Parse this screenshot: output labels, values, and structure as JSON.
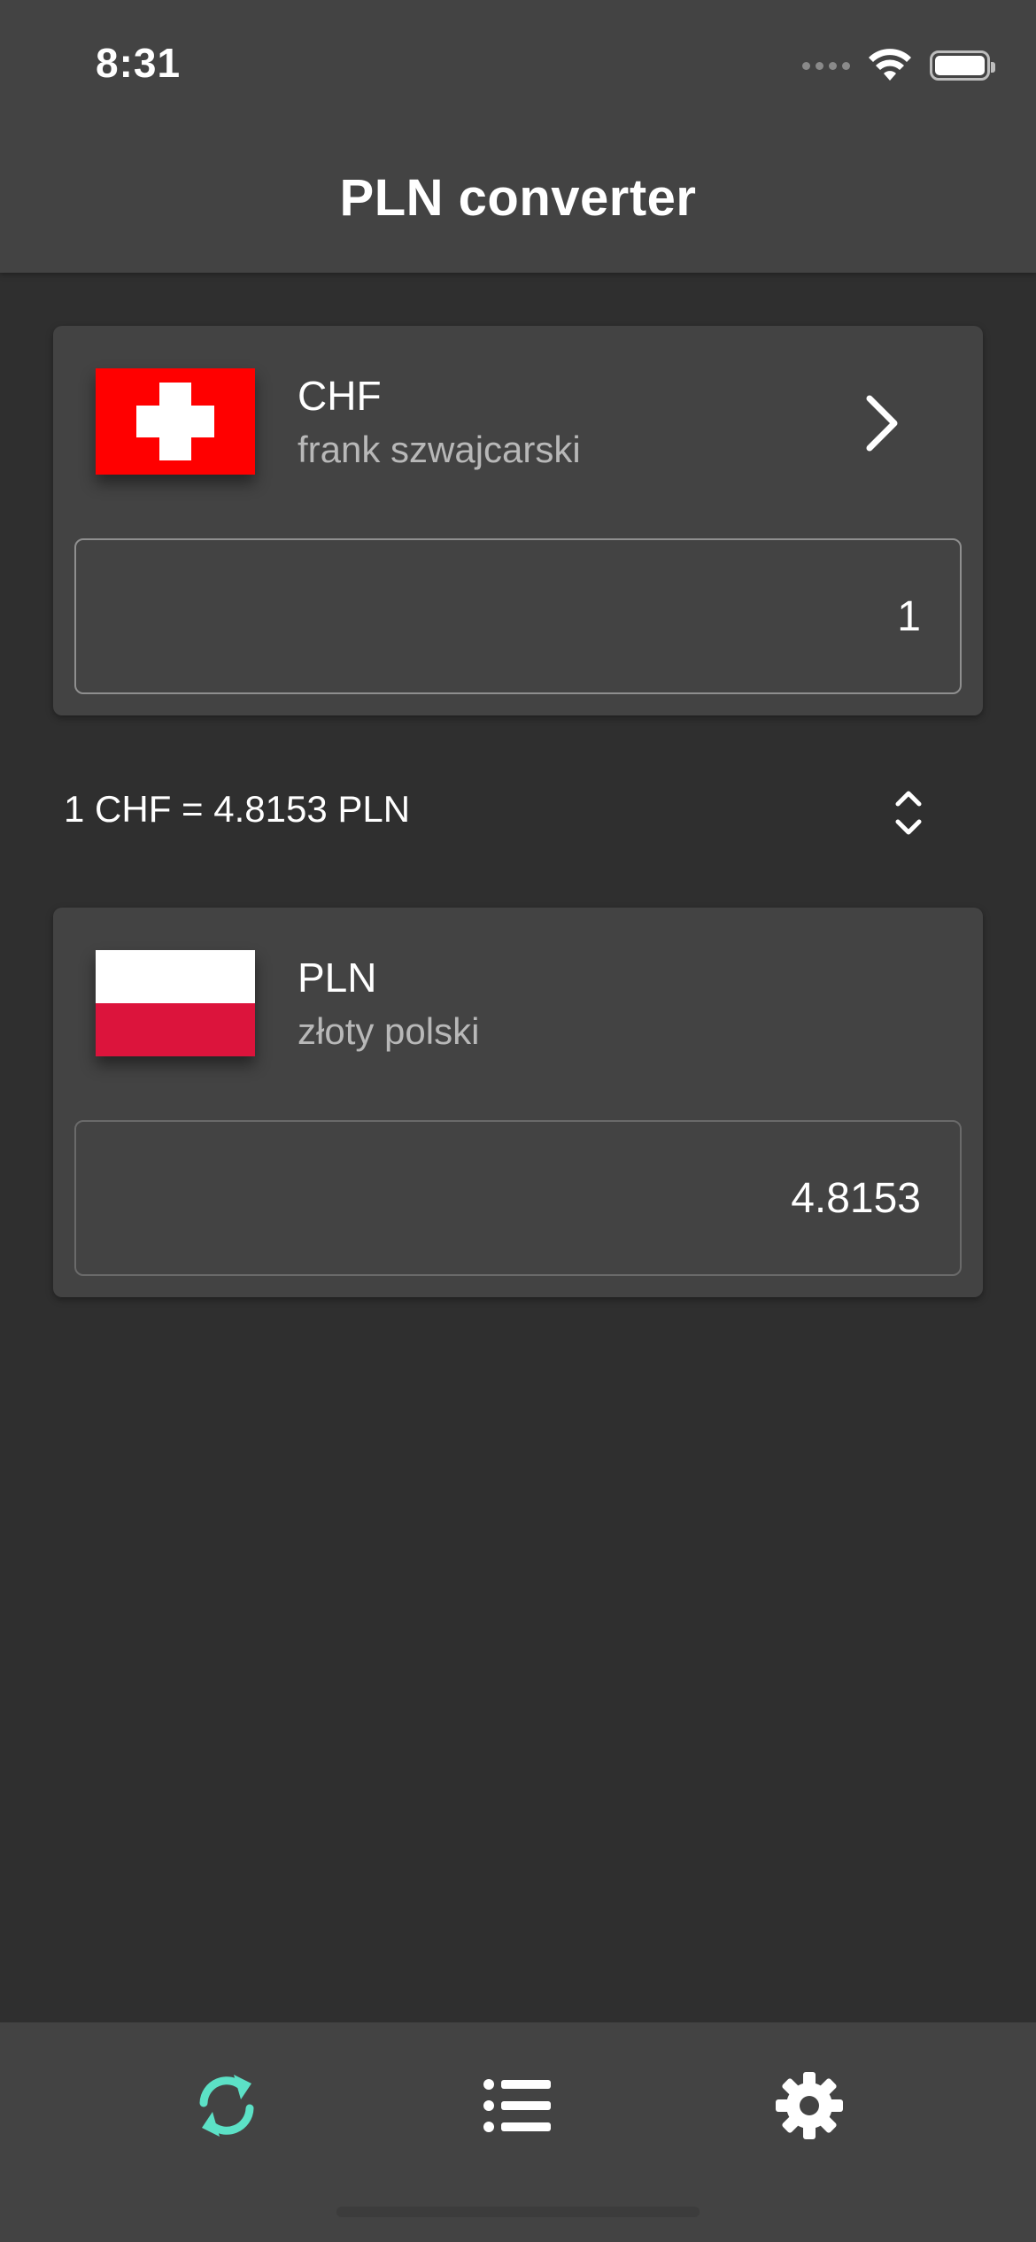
{
  "status_bar": {
    "time": "8:31"
  },
  "header": {
    "title": "PLN converter"
  },
  "from_currency": {
    "code": "CHF",
    "name": "frank szwajcarski",
    "amount": "1",
    "flag": "swiss-flag"
  },
  "rate": {
    "text": "1 CHF = 4.8153 PLN"
  },
  "to_currency": {
    "code": "PLN",
    "name": "złoty polski",
    "amount": "4.8153",
    "flag": "polish-flag"
  },
  "bottom_nav": {
    "items": [
      {
        "name": "convert",
        "icon": "refresh-icon",
        "active": true
      },
      {
        "name": "list",
        "icon": "list-icon",
        "active": false
      },
      {
        "name": "settings",
        "icon": "gear-icon",
        "active": false
      }
    ]
  },
  "colors": {
    "accent": "#5ce1c6",
    "background": "#2f2f2f",
    "surface": "#434343",
    "muted_text": "#b8b8b8"
  }
}
